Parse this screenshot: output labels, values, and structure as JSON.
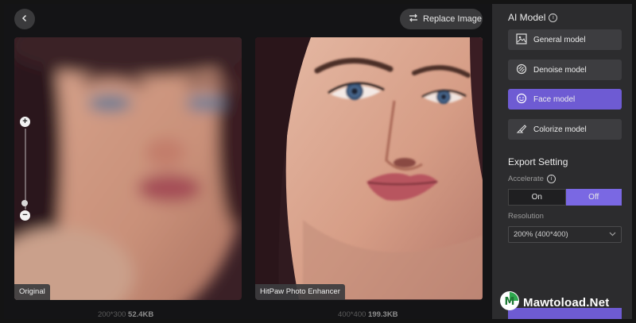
{
  "header": {
    "replace_label": "Replace Image"
  },
  "preview": {
    "original_tag": "Original",
    "enhanced_tag": "HitPaw Photo Enhancer",
    "original_dims": "200*300",
    "original_size": "52.4KB",
    "enhanced_dims": "400*400",
    "enhanced_size": "199.3KB"
  },
  "zoom": {
    "plus": "+",
    "minus": "−",
    "level": 0.1
  },
  "sidebar": {
    "ai_model_title": "AI Model",
    "models": [
      {
        "label": "General model",
        "icon": "image-icon",
        "active": false
      },
      {
        "label": "Denoise model",
        "icon": "denoise-icon",
        "active": false
      },
      {
        "label": "Face model",
        "icon": "face-icon",
        "active": true
      },
      {
        "label": "Colorize model",
        "icon": "colorize-icon",
        "active": false
      }
    ],
    "export_title": "Export Setting",
    "accelerate_label": "Accelerate",
    "toggle_on": "On",
    "toggle_off": "Off",
    "toggle_selected": "Off",
    "resolution_label": "Resolution",
    "resolution_value": "200% (400*400)"
  },
  "watermark": {
    "text": "Mawtoload.Net",
    "logo_letter": "M"
  },
  "colors": {
    "accent": "#6e5bd3",
    "toggle_accent": "#7a68e3",
    "panel_bg": "#2c2c2e"
  }
}
